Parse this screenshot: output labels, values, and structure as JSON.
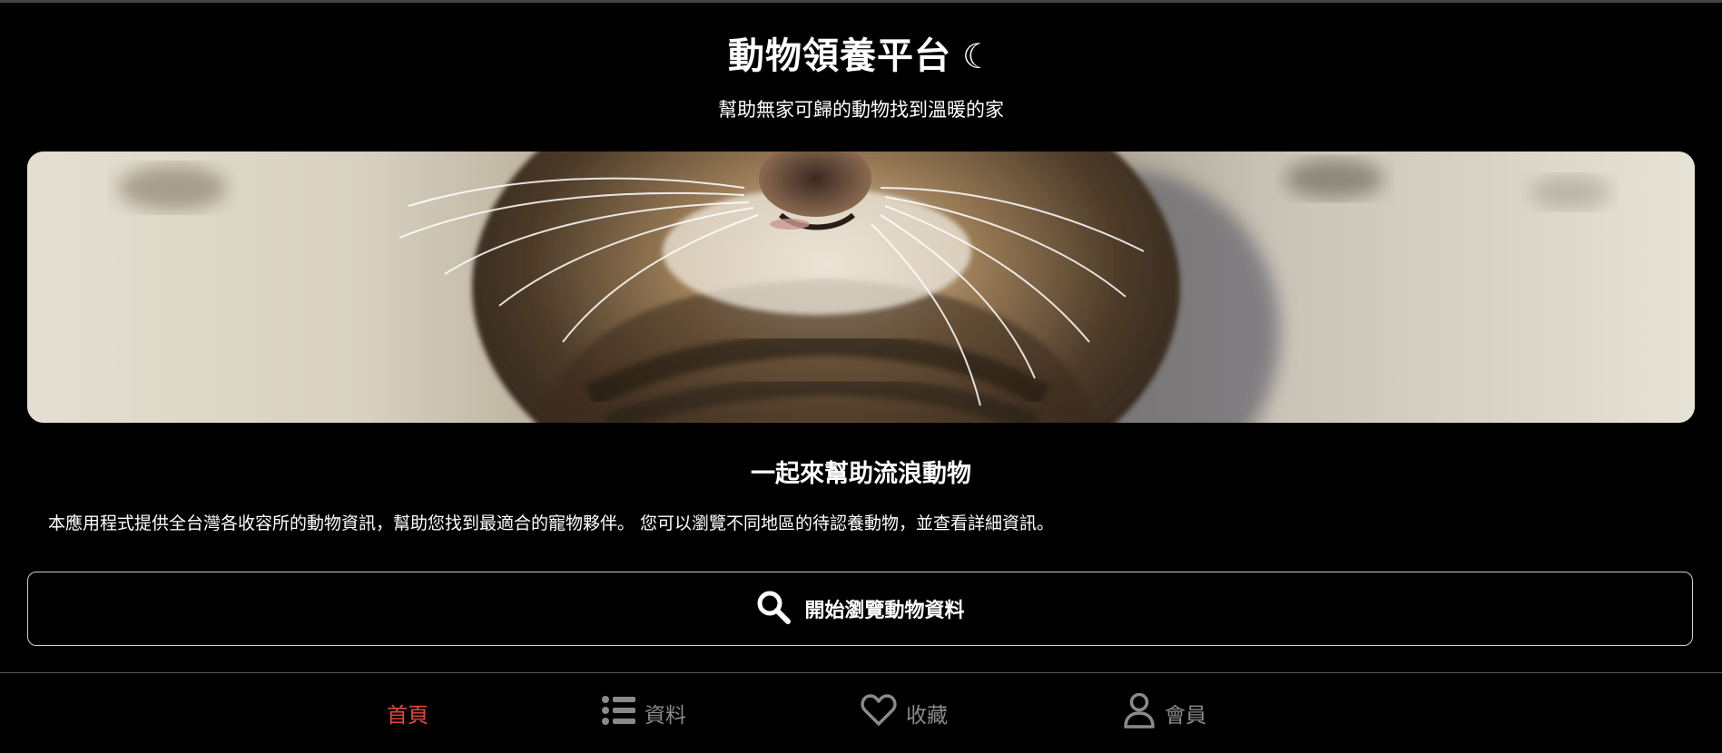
{
  "header": {
    "title": "動物領養平台",
    "theme_toggle_glyph": "☾",
    "subtitle": "幫助無家可歸的動物找到溫暖的家"
  },
  "hero": {
    "image_subject": "tabby-kitten-closeup"
  },
  "main": {
    "section_title": "一起來幫助流浪動物",
    "description": "本應用程式提供全台灣各收容所的動物資訊，幫助您找到最適合的寵物夥伴。 您可以瀏覽不同地區的待認養動物，並查看詳細資訊。",
    "browse_button": {
      "icon": "search-icon",
      "label": "開始瀏覽動物資料"
    }
  },
  "bottom_nav": {
    "items": [
      {
        "label": "首頁",
        "icon": "",
        "active": true
      },
      {
        "label": "資料",
        "icon": "list-icon",
        "active": false
      },
      {
        "label": "收藏",
        "icon": "heart-icon",
        "active": false
      },
      {
        "label": "會員",
        "icon": "user-icon",
        "active": false
      }
    ]
  },
  "colors": {
    "background": "#000000",
    "text": "#ffffff",
    "nav_active": "#e2483d",
    "nav_inactive": "#8a8a8a"
  }
}
